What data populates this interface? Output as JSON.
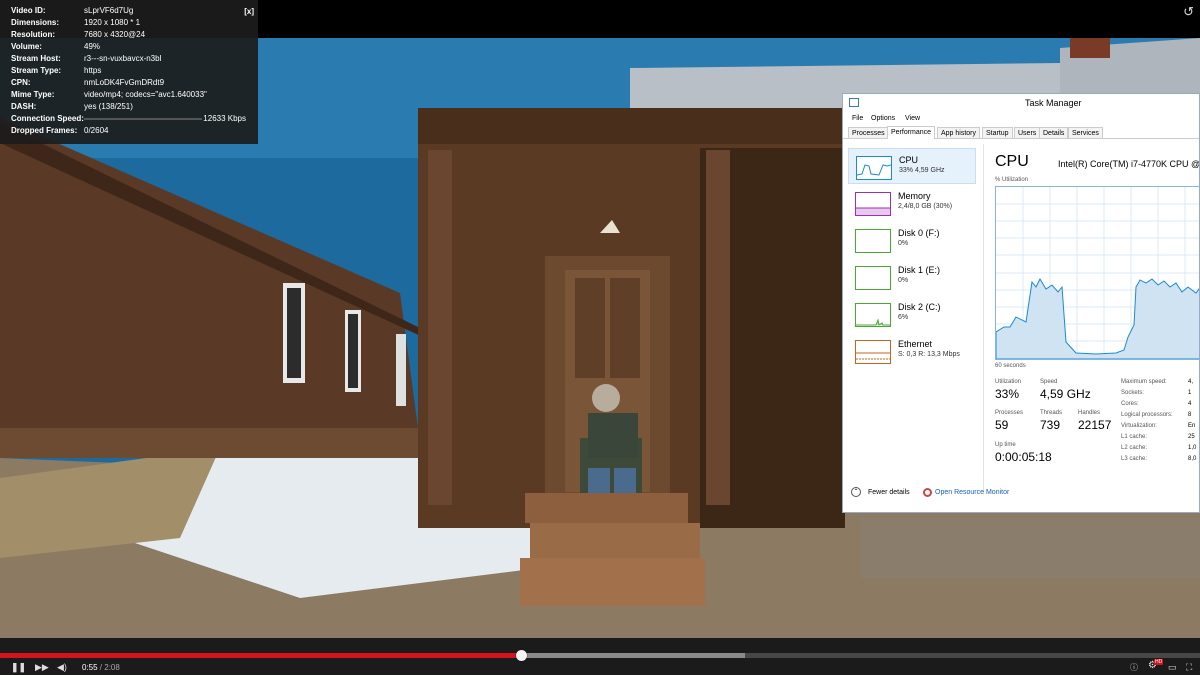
{
  "stats": {
    "close": "[x]",
    "rows": [
      {
        "k": "Video ID:",
        "v": "sLprVF6d7Ug"
      },
      {
        "k": "Dimensions:",
        "v": "1920 x 1080 * 1"
      },
      {
        "k": "Resolution:",
        "v": "7680 x 4320@24"
      },
      {
        "k": "Volume:",
        "v": "49%"
      },
      {
        "k": "Stream Host:",
        "v": "r3---sn-vuxbavcx-n3bl"
      },
      {
        "k": "Stream Type:",
        "v": "https"
      },
      {
        "k": "CPN:",
        "v": "nmLoDK4FvGmDRdt9"
      },
      {
        "k": "Mime Type:",
        "v": "video/mp4; codecs=\"avc1.640033\""
      },
      {
        "k": "DASH:",
        "v": "yes (138/251)"
      },
      {
        "k": "Connection Speed:",
        "v": "12633 Kbps"
      },
      {
        "k": "Dropped Frames:",
        "v": "0/2604"
      }
    ]
  },
  "taskmanager": {
    "title": "Task Manager",
    "menu": [
      "File",
      "Options",
      "View"
    ],
    "tabs": [
      "Processes",
      "Performance",
      "App history",
      "Startup",
      "Users",
      "Details",
      "Services"
    ],
    "active_tab": "Performance",
    "side": [
      {
        "name": "CPU",
        "value": "33% 4,59 GHz",
        "color": "#1a8ad4"
      },
      {
        "name": "Memory",
        "value": "2,4/8,0 GB (30%)",
        "color": "#9b2fae"
      },
      {
        "name": "Disk 0 (F:)",
        "value": "0%",
        "color": "#4aa832"
      },
      {
        "name": "Disk 1 (E:)",
        "value": "0%",
        "color": "#4aa832"
      },
      {
        "name": "Disk 2 (C:)",
        "value": "6%",
        "color": "#4aa832"
      },
      {
        "name": "Ethernet",
        "value": "S: 0,3  R: 13,3 Mbps",
        "color": "#c9631d"
      }
    ],
    "cpu": {
      "heading": "CPU",
      "name": "Intel(R) Core(TM) i7-4770K CPU @",
      "util_label": "% Utilization",
      "sixty": "60 seconds",
      "utilization_label": "Utilization",
      "utilization": "33%",
      "speed_label": "Speed",
      "speed": "4,59 GHz",
      "processes_label": "Processes",
      "processes": "59",
      "threads_label": "Threads",
      "threads": "739",
      "handles_label": "Handles",
      "handles": "22157",
      "uptime_label": "Up time",
      "uptime": "0:00:05:18",
      "specs": [
        {
          "k": "Maximum speed:",
          "v": "4,"
        },
        {
          "k": "Sockets:",
          "v": "1"
        },
        {
          "k": "Cores:",
          "v": "4"
        },
        {
          "k": "Logical processors:",
          "v": "8"
        },
        {
          "k": "Virtualization:",
          "v": "En"
        },
        {
          "k": "L1 cache:",
          "v": "25"
        },
        {
          "k": "L2 cache:",
          "v": "1,0"
        },
        {
          "k": "L3 cache:",
          "v": "8,0"
        }
      ]
    },
    "footer": {
      "fewer": "Fewer details",
      "resource": "Open Resource Monitor"
    }
  },
  "player": {
    "current": "0:55",
    "separator": " / ",
    "total": "2:08",
    "played_fraction": 0.434,
    "buffered_fraction": 0.621,
    "hd": "HD"
  }
}
